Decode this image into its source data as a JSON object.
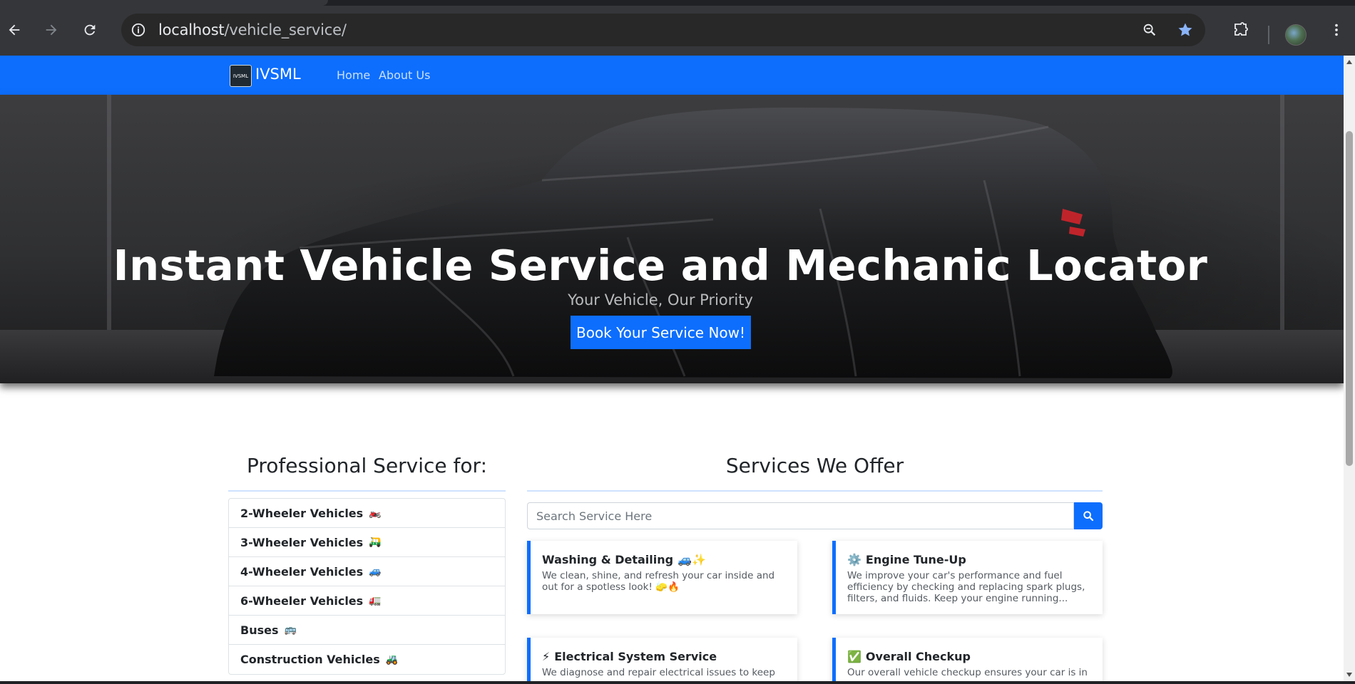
{
  "browser": {
    "url_host": "localhost",
    "url_path": "/vehicle_service/"
  },
  "navbar": {
    "brand_logo_text": "IVSML",
    "brand": "IVSML",
    "links": [
      "Home",
      "About Us"
    ]
  },
  "hero": {
    "title": "Instant Vehicle Service and Mechanic Locator",
    "subtitle": "Your Vehicle, Our Priority",
    "cta": "Book Your Service Now!"
  },
  "vehicles": {
    "heading": "Professional Service for:",
    "items": [
      {
        "label": "2-Wheeler Vehicles",
        "emoji": "🏍️"
      },
      {
        "label": "3-Wheeler Vehicles",
        "emoji": "🛺"
      },
      {
        "label": "4-Wheeler Vehicles",
        "emoji": "🚙"
      },
      {
        "label": "6-Wheeler Vehicles",
        "emoji": "🚛"
      },
      {
        "label": "Buses",
        "emoji": "🚌"
      },
      {
        "label": "Construction Vehicles",
        "emoji": "🚜"
      }
    ]
  },
  "services": {
    "heading": "Services We Offer",
    "search_placeholder": "Search Service Here",
    "cards": [
      {
        "title": "Washing & Detailing",
        "icon": "🚙✨",
        "desc": "We clean, shine, and refresh your car inside and out for a spotless look! 🧽🔥"
      },
      {
        "title": "Engine Tune-Up",
        "icon": "⚙️",
        "desc": "We improve your car's performance and fuel efficiency by checking and replacing spark plugs, filters, and fluids. Keep your engine running..."
      },
      {
        "title": "Electrical System Service",
        "icon": "⚡",
        "desc": "We diagnose and repair electrical issues to keep"
      },
      {
        "title": "Overall Checkup",
        "icon": "✅",
        "desc": "Our overall vehicle checkup ensures your car is in"
      }
    ]
  },
  "colors": {
    "primary": "#0d6efd",
    "navbar": "#0d6efd",
    "text": "#212529"
  }
}
